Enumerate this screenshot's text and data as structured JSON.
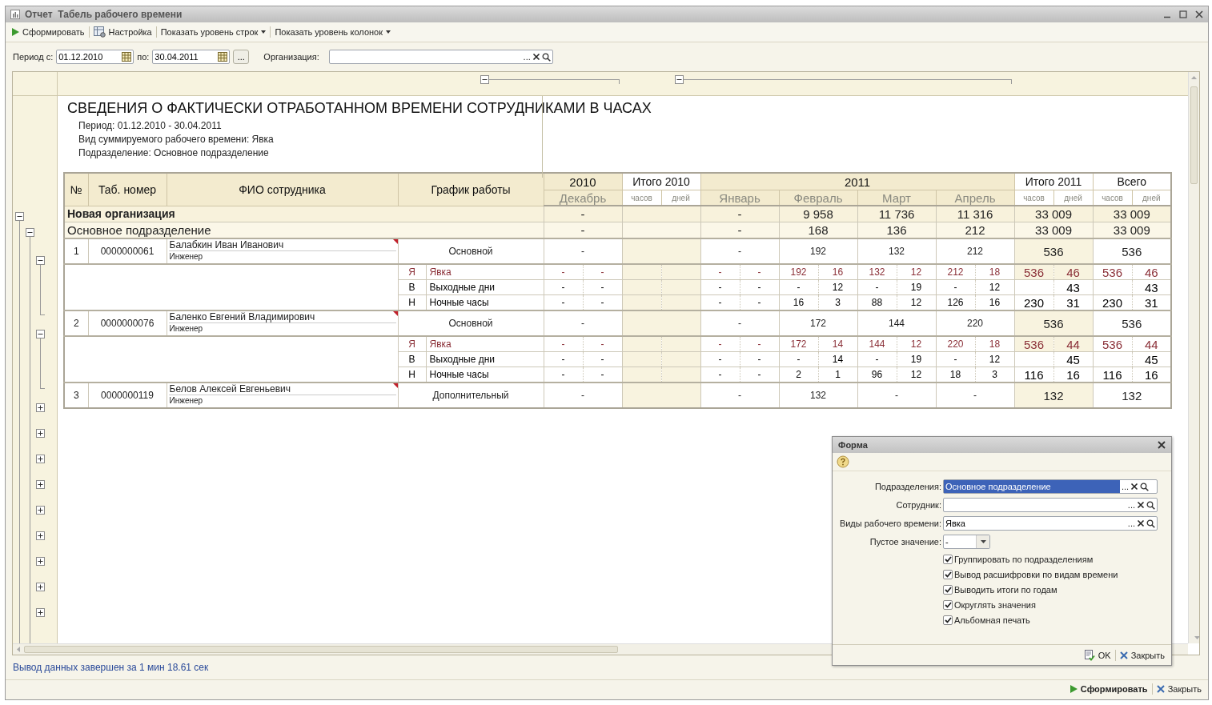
{
  "window": {
    "title": "Отчет  Табель рабочего времени"
  },
  "toolbar": [
    {
      "kind": "run",
      "label": "Сформировать"
    },
    {
      "kind": "settings",
      "label": "Настройка"
    },
    {
      "kind": "menu",
      "label": "Показать уровень строк"
    },
    {
      "kind": "menu",
      "label": "Показать уровень колонок"
    }
  ],
  "filters": {
    "period_from_label": "Период с:",
    "period_from": "01.12.2010",
    "period_to_label": "по:",
    "period_to": "30.04.2011",
    "period_button": "...",
    "organization_label": "Организация:",
    "organization_button": "..."
  },
  "column_groups": [
    {
      "expanded": true
    },
    {
      "expanded": true
    }
  ],
  "report": {
    "title": "СВЕДЕНИЯ О ФАКТИЧЕСКИ ОТРАБОТАННОМ ВРЕМЕНИ СОТРУДНИКАМИ В ЧАСАХ",
    "lines": [
      "Период: 01.12.2010 - 30.04.2011",
      "Вид суммируемого рабочего времени: Явка",
      "Подразделение: Основное подразделение"
    ]
  },
  "table": {
    "columns": {
      "no": "№",
      "tab": "Таб. номер",
      "name": "ФИО сотрудника",
      "schedule": "График работы"
    },
    "groups": [
      {
        "kind": "period",
        "label": "2010",
        "months": [
          "Декабрь"
        ]
      },
      {
        "kind": "blank_total",
        "label": "Итого 2010",
        "sub": [
          "часов",
          "дней"
        ]
      },
      {
        "kind": "period",
        "label": "2011",
        "months": [
          "Январь",
          "Февраль",
          "Март",
          "Апрель"
        ]
      },
      {
        "kind": "shaded_total",
        "label": "Итого 2011",
        "sub": [
          "часов",
          "дней"
        ]
      },
      {
        "kind": "total",
        "label": "Всего",
        "sub": [
          "часов",
          "дней"
        ]
      }
    ],
    "rows": [
      {
        "kind": "organization",
        "name": "Новая организация",
        "expanded": true,
        "values": [
          "-",
          "-",
          "9 958",
          "11 736",
          "11 316",
          "33 009",
          "33 009"
        ]
      },
      {
        "kind": "department",
        "name": "Основное подразделение",
        "expanded": true,
        "values": [
          "-",
          "-",
          "168",
          "136",
          "212",
          "33 009",
          "33 009"
        ]
      },
      {
        "kind": "employee",
        "no": "1",
        "tab": "0000000061",
        "name": "Балабкин Иван Иванович",
        "position": "Инженер",
        "schedule": "Основной",
        "expanded": true,
        "values": [
          "-",
          "-",
          "192",
          "132",
          "212",
          "536",
          "536"
        ],
        "details": [
          {
            "code": "Я",
            "name": "Явка",
            "color": "#8b3038",
            "values": [
              {
                "hours": "-",
                "days": "-"
              },
              {
                "hours": "-",
                "days": "-"
              },
              {
                "hours": "192",
                "days": "16"
              },
              {
                "hours": "132",
                "days": "12"
              },
              {
                "hours": "212",
                "days": "18"
              },
              {
                "hours": "536",
                "days": "46"
              },
              {
                "hours": "536",
                "days": "46"
              }
            ]
          },
          {
            "code": "В",
            "name": "Выходные дни",
            "color": "#000000",
            "values": [
              {
                "hours": "-",
                "days": "-"
              },
              {
                "hours": "-",
                "days": "-"
              },
              {
                "hours": "-",
                "days": "12"
              },
              {
                "hours": "-",
                "days": "19"
              },
              {
                "hours": "-",
                "days": "12"
              },
              {
                "days": "43"
              },
              {
                "days": "43"
              }
            ]
          },
          {
            "code": "Н",
            "name": "Ночные часы",
            "color": "#000000",
            "values": [
              {
                "hours": "-",
                "days": "-"
              },
              {
                "hours": "-",
                "days": "-"
              },
              {
                "hours": "16",
                "days": "3"
              },
              {
                "hours": "88",
                "days": "12"
              },
              {
                "hours": "126",
                "days": "16"
              },
              {
                "hours": "230",
                "days": "31"
              },
              {
                "hours": "230",
                "days": "31"
              }
            ]
          }
        ]
      },
      {
        "kind": "employee",
        "no": "2",
        "tab": "0000000076",
        "name": "Баленко Евгений Владимирович",
        "position": "Инженер",
        "schedule": "Основной",
        "expanded": true,
        "values": [
          "-",
          "-",
          "172",
          "144",
          "220",
          "536",
          "536"
        ],
        "details": [
          {
            "code": "Я",
            "name": "Явка",
            "color": "#8b3038",
            "values": [
              {
                "hours": "-",
                "days": "-"
              },
              {
                "hours": "-",
                "days": "-"
              },
              {
                "hours": "172",
                "days": "14"
              },
              {
                "hours": "144",
                "days": "12"
              },
              {
                "hours": "220",
                "days": "18"
              },
              {
                "hours": "536",
                "days": "44"
              },
              {
                "hours": "536",
                "days": "44"
              }
            ]
          },
          {
            "code": "В",
            "name": "Выходные дни",
            "color": "#000000",
            "values": [
              {
                "hours": "-",
                "days": "-"
              },
              {
                "hours": "-",
                "days": "-"
              },
              {
                "hours": "-",
                "days": "14"
              },
              {
                "hours": "-",
                "days": "19"
              },
              {
                "hours": "-",
                "days": "12"
              },
              {
                "days": "45"
              },
              {
                "days": "45"
              }
            ]
          },
          {
            "code": "Н",
            "name": "Ночные часы",
            "color": "#000000",
            "values": [
              {
                "hours": "-",
                "days": "-"
              },
              {
                "hours": "-",
                "days": "-"
              },
              {
                "hours": "2",
                "days": "1"
              },
              {
                "hours": "96",
                "days": "12"
              },
              {
                "hours": "18",
                "days": "3"
              },
              {
                "hours": "116",
                "days": "16"
              },
              {
                "hours": "116",
                "days": "16"
              }
            ]
          }
        ]
      },
      {
        "kind": "employee",
        "no": "3",
        "tab": "0000000119",
        "name": "Белов Алексей Евгеньевич",
        "position": "Инженер",
        "schedule": "Дополнительный",
        "expanded": false,
        "values": [
          "-",
          "-",
          "132",
          "-",
          "-",
          "132",
          "132"
        ]
      }
    ]
  },
  "collapsed_groups": [
    {
      "expanded": false
    },
    {
      "expanded": false
    },
    {
      "expanded": false
    },
    {
      "expanded": false
    },
    {
      "expanded": false
    },
    {
      "expanded": false
    },
    {
      "expanded": false
    },
    {
      "expanded": false
    }
  ],
  "status": "Вывод данных завершен за 1 мин 18.61 сек",
  "footer_buttons": [
    {
      "kind": "run",
      "label": "Сформировать"
    },
    {
      "kind": "close",
      "label": "Закрыть"
    }
  ],
  "form": {
    "title": "Форма",
    "fields": [
      {
        "label": "Подразделения:",
        "value": "Основное подразделение",
        "button": "...",
        "selected": true
      },
      {
        "label": "Сотрудник:",
        "button": "...",
        "selected": false
      },
      {
        "label": "Виды рабочего времени:",
        "value": "Явка",
        "button": "...",
        "selected": false
      }
    ],
    "empty_value": {
      "label": "Пустое значение:",
      "value": "-"
    },
    "options": [
      {
        "label": "Группировать по подразделениям",
        "checked": true
      },
      {
        "label": "Вывод расшифровки по видам времени",
        "checked": true
      },
      {
        "label": "Выводить итоги по годам",
        "checked": true
      },
      {
        "label": "Округлять значения",
        "checked": true
      },
      {
        "label": "Альбомная печать",
        "checked": true
      }
    ],
    "buttons": [
      {
        "kind": "ok",
        "label": "OK"
      },
      {
        "kind": "close",
        "label": "Закрыть"
      }
    ]
  }
}
